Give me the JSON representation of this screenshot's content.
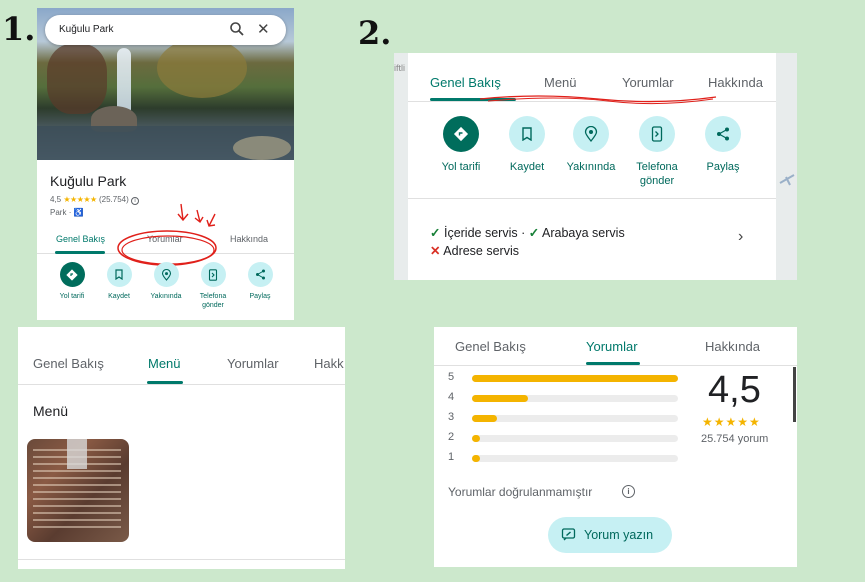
{
  "steps": {
    "one": "1.",
    "two": "2."
  },
  "place": {
    "name": "Kuğulu Park",
    "search_value": "Kuğulu Park",
    "rating": "4,5",
    "stars": "★★★★★",
    "review_count_paren": "(25.754)",
    "category": "Park"
  },
  "tabs": {
    "overview": "Genel Bakış",
    "menu": "Menü",
    "reviews": "Yorumlar",
    "about": "Hakkında",
    "about_cut": "Hakk"
  },
  "actions": {
    "directions": "Yol tarifi",
    "save": "Kaydet",
    "nearby": "Yakınında",
    "send_phone_l1": "Telefona",
    "send_phone_l2": "gönder",
    "share": "Paylaş"
  },
  "map_fragment": "iftli",
  "services": {
    "dine_in": "İçeride servis",
    "separator": "·",
    "drive_through": "Arabaya servis",
    "delivery": "Adrese servis"
  },
  "menu_section": {
    "heading": "Menü"
  },
  "reviews_panel": {
    "distribution": [
      {
        "star": "5",
        "fraction": 1.0
      },
      {
        "star": "4",
        "fraction": 0.27
      },
      {
        "star": "3",
        "fraction": 0.12
      },
      {
        "star": "2",
        "fraction": 0.04
      },
      {
        "star": "1",
        "fraction": 0.04
      }
    ],
    "average": "4,5",
    "stars": "★★★★★",
    "count_label": "25.754 yorum",
    "unverified_note": "Yorumlar doğrulanmamıştır",
    "write_button": "Yorum yazın"
  },
  "colors": {
    "accent": "#00796b",
    "star": "#f4b400",
    "annotation": "#e0201a"
  }
}
